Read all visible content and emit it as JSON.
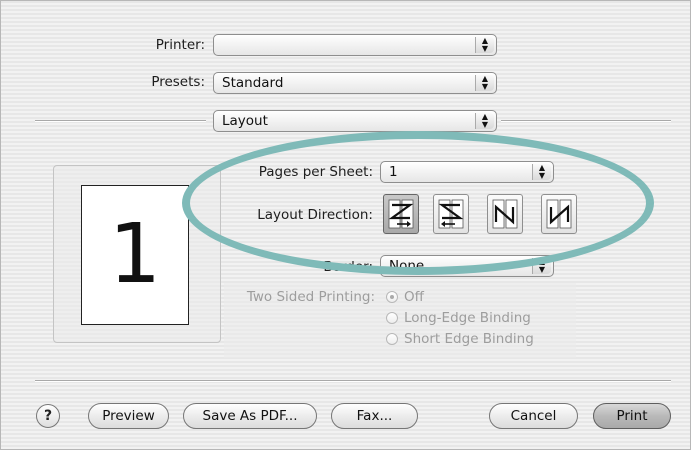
{
  "printer": {
    "label": "Printer:",
    "value": ""
  },
  "presets": {
    "label": "Presets:",
    "value": "Standard"
  },
  "panel": {
    "value": "Layout"
  },
  "preview": {
    "page_number": "1"
  },
  "layout": {
    "pages_per_sheet_label": "Pages per Sheet:",
    "pages_per_sheet_value": "1",
    "direction_label": "Layout Direction:",
    "directions": [
      "z-right-down",
      "z-left-down",
      "n-down-right",
      "n-down-left"
    ],
    "selected_direction_index": 0,
    "border_label": "Border:",
    "border_value": "None"
  },
  "two_sided": {
    "label": "Two Sided Printing:",
    "options": [
      "Off",
      "Long-Edge Binding",
      "Short Edge Binding"
    ],
    "selected": "Off"
  },
  "buttons": {
    "help": "?",
    "preview": "Preview",
    "save_pdf": "Save As PDF...",
    "fax": "Fax...",
    "cancel": "Cancel",
    "print": "Print"
  },
  "colors": {
    "highlight": "#7fbab8"
  }
}
